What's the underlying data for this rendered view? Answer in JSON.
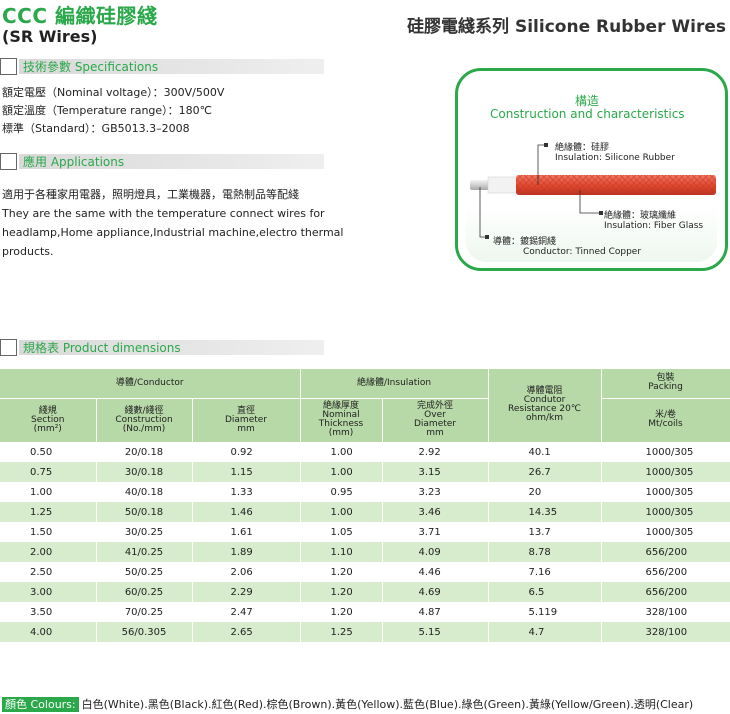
{
  "header": {
    "title": "CCC 編織硅膠綫",
    "subtitle": "(SR Wires)",
    "series": "硅膠電綫系列 Silicone Rubber Wires"
  },
  "specifications": {
    "heading": "技術參數 Specifications",
    "lines": [
      "額定電壓（Nominal voltage）：300V/500V",
      "額定溫度（Temperature range）：180℃",
      "標準（Standard）：GB5013.3–2008"
    ]
  },
  "applications": {
    "heading": "應用 Applications",
    "lines": [
      "適用于各種家用電器，照明燈具，工業機器，電熱制品等配綫",
      "They are the same with the temperature connect wires for",
      "headlamp,Home appliance,Industrial machine,electro thermal",
      "products."
    ]
  },
  "construction": {
    "title_zh": "構造",
    "title_en": "Construction and characteristics",
    "labels": [
      {
        "zh": "絶緣體：硅膠",
        "en": "Insulation: Silicone Rubber"
      },
      {
        "zh": "絶緣體：玻璃纖維",
        "en": "Insulation: Fiber Glass"
      },
      {
        "zh": "導體：鍍錫銅綫",
        "en": "Conductor: Tinned Copper"
      }
    ],
    "colors": {
      "accent": "#2aa84a",
      "jacket": "#e34a32",
      "conductor": "#d8d8d8"
    }
  },
  "dimensions": {
    "heading": "規格表 Product dimensions",
    "group_headers": {
      "conductor": "導體/Conductor",
      "insulation": "絶緣體/Insulation",
      "resistance": [
        "導體電阻",
        "Condutor",
        "Resistance 20℃",
        "ohm/km"
      ],
      "packing": [
        "包裝",
        "Packing"
      ]
    },
    "column_headers": {
      "section": [
        "綫規",
        "Section",
        "(mm²)"
      ],
      "construction": [
        "綫數/綫徑",
        "Construction",
        "(No./mm)"
      ],
      "diameter": [
        "直徑",
        "Diameter",
        "mm"
      ],
      "thickness": [
        "絶緣厚度",
        "Nominal",
        "Thickness",
        "(mm)"
      ],
      "over_diameter": [
        "完成外徑",
        "Over",
        "Diameter",
        "mm"
      ],
      "packing_unit": [
        "米/卷",
        "Mt/coils"
      ]
    },
    "rows": [
      [
        "0.50",
        "20/0.18",
        "0.92",
        "1.00",
        "2.92",
        "40.1",
        "1000/305"
      ],
      [
        "0.75",
        "30/0.18",
        "1.15",
        "1.00",
        "3.15",
        "26.7",
        "1000/305"
      ],
      [
        "1.00",
        "40/0.18",
        "1.33",
        "0.95",
        "3.23",
        "20",
        "1000/305"
      ],
      [
        "1.25",
        "50/0.18",
        "1.46",
        "1.00",
        "3.46",
        "14.35",
        "1000/305"
      ],
      [
        "1.50",
        "30/0.25",
        "1.61",
        "1.05",
        "3.71",
        "13.7",
        "1000/305"
      ],
      [
        "2.00",
        "41/0.25",
        "1.89",
        "1.10",
        "4.09",
        "8.78",
        "656/200"
      ],
      [
        "2.50",
        "50/0.25",
        "2.06",
        "1.20",
        "4.46",
        "7.16",
        "656/200"
      ],
      [
        "3.00",
        "60/0.25",
        "2.29",
        "1.20",
        "4.69",
        "6.5",
        "656/200"
      ],
      [
        "3.50",
        "70/0.25",
        "2.47",
        "1.20",
        "4.87",
        "5.119",
        "328/100"
      ],
      [
        "4.00",
        "56/0.305",
        "2.65",
        "1.25",
        "5.15",
        "4.7",
        "328/100"
      ]
    ]
  },
  "colours": {
    "label": "顏色 Colours:",
    "text": "白色(White).黑色(Black).紅色(Red).棕色(Brown).黃色(Yellow).藍色(Blue).綠色(Green).黃綠(Yellow/Green).透明(Clear)"
  }
}
